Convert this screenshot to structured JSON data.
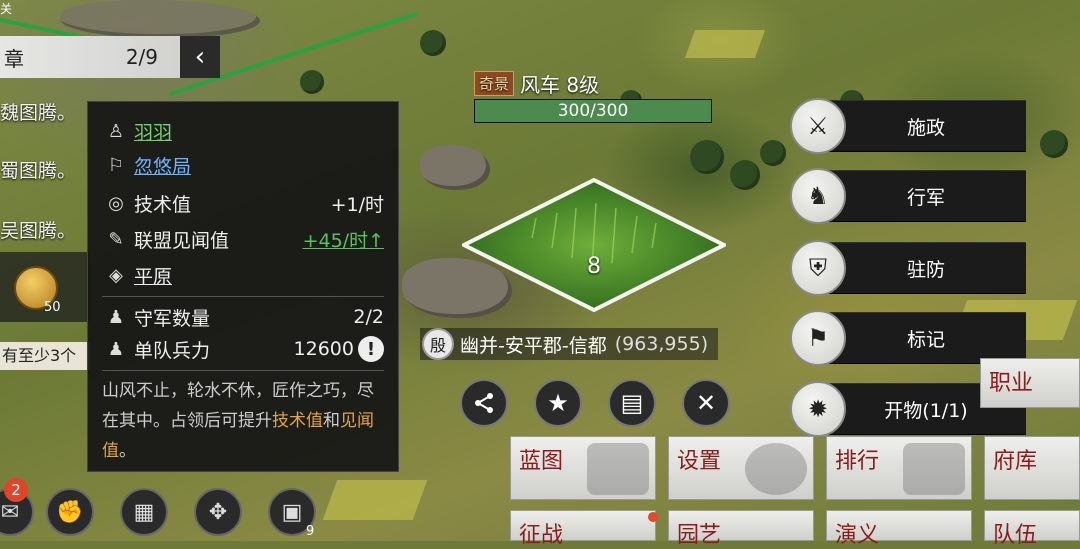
{
  "corner_char": "关",
  "chapter": {
    "label": "章",
    "progress": "2/9"
  },
  "quests": [
    {
      "text": "魏图腾。"
    },
    {
      "text": "蜀图腾。"
    },
    {
      "text": "吴图腾。"
    }
  ],
  "quest_reward_count": "50",
  "quest_hint": "有至少3个",
  "tile": {
    "tag": "奇景",
    "name": "风车 8级",
    "durability": "300/300",
    "durability_fraction": 1.0,
    "level": "8"
  },
  "info_panel": {
    "owner": "羽羽",
    "alliance": "忽悠局",
    "tech_label": "技术值",
    "tech_value": "+1/时",
    "exp_label": "联盟见闻值",
    "exp_value": "+45/时",
    "terrain": "平原",
    "garrison_label": "守军数量",
    "garrison_value": "2/2",
    "troop_label": "单队兵力",
    "troop_value": "12600",
    "desc_1": "山风不止，轮水不休，匠作之巧，尽在其中。占领后可提升",
    "desc_hl1": "技术值",
    "desc_and": "和",
    "desc_hl2": "见闻值",
    "desc_end": "。"
  },
  "location": {
    "badge": "殷",
    "path": "幽并-安平郡-信都",
    "coords": "(963,955)"
  },
  "actions": [
    {
      "icon": "share-icon",
      "glyph": "⋖"
    },
    {
      "icon": "star-icon",
      "glyph": "★"
    },
    {
      "icon": "book-icon",
      "glyph": "▤"
    },
    {
      "icon": "close-icon",
      "glyph": "✕"
    }
  ],
  "commands": [
    {
      "label": "施政",
      "icon": "govern-icon"
    },
    {
      "label": "行军",
      "icon": "march-icon"
    },
    {
      "label": "驻防",
      "icon": "shield-icon"
    },
    {
      "label": "标记",
      "icon": "flag-icon"
    },
    {
      "label": "开物(1/1)",
      "icon": "craft-icon"
    }
  ],
  "grid_buttons": [
    {
      "label": "蓝图"
    },
    {
      "label": "设置"
    },
    {
      "label": "排行"
    },
    {
      "label": "府库"
    },
    {
      "label": "征战"
    },
    {
      "label": "园艺"
    },
    {
      "label": "演义"
    },
    {
      "label": "队伍"
    },
    {
      "label": "职业"
    }
  ],
  "toolbar_badge": "2",
  "toolbar_count": "9",
  "colors": {
    "accent_green": "#56c25b",
    "link_blue": "#6fb4ff",
    "highlight_orange": "#e8a53a",
    "label_red": "#8a1b1b"
  }
}
